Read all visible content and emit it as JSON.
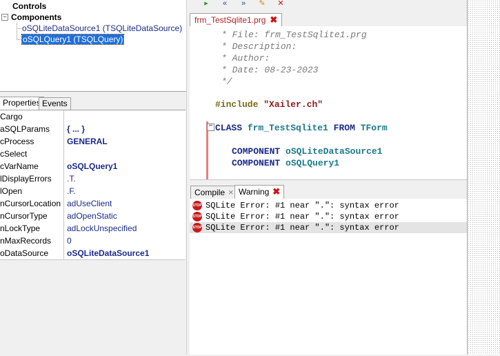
{
  "tree": {
    "controls": "Controls",
    "components": "Components",
    "items": [
      "oSQLiteDataSource1  (TSQLiteDataSource)",
      "oSQLQuery1  (TSQLQuery)"
    ],
    "expander_symbol": "−"
  },
  "property_tabs": [
    "Properties",
    "Events"
  ],
  "properties": [
    {
      "name": "Cargo",
      "value": ""
    },
    {
      "name": "aSQLParams",
      "value": "{ ... }"
    },
    {
      "name": "cProcess",
      "value": "GENERAL"
    },
    {
      "name": "cSelect",
      "value": ""
    },
    {
      "name": "cVarName",
      "value": "oSQLQuery1"
    },
    {
      "name": "lDisplayErrors",
      "value": ".T."
    },
    {
      "name": "lOpen",
      "value": ".F."
    },
    {
      "name": "nCursorLocation",
      "value": "adUseClient"
    },
    {
      "name": "nCursorType",
      "value": "adOpenStatic"
    },
    {
      "name": "nLockType",
      "value": "adLockUnspecified"
    },
    {
      "name": "nMaxRecords",
      "value": "0"
    },
    {
      "name": "oDataSource",
      "value": "oSQLiteDataSource1"
    }
  ],
  "toolbar_icons": [
    "run-icon",
    "back-icon",
    "forward-icon",
    "edit-icon",
    "delete-icon"
  ],
  "editor": {
    "tab_label": "frm_TestSqlite1.prg",
    "lines": {
      "c1": "* File: frm_TestSqlite1.prg",
      "c2": "* Description:",
      "c3": "* Author:",
      "c4": "* Date: 08-23-2023",
      "c5": "*/",
      "include_kw": "#include",
      "include_str": "\"Xailer.ch\"",
      "class_kw": "CLASS",
      "class_name": "frm_TestSqlite1",
      "from_kw": "FROM",
      "parent": "TForm",
      "comp_kw": "COMPONENT",
      "comp1": "oSQLiteDataSource1",
      "comp2": "oSQLQuery1"
    },
    "fold_symbol": "−"
  },
  "output": {
    "tabs": [
      {
        "label": "Compile",
        "close": "×"
      },
      {
        "label": "Warning",
        "close": "✖"
      }
    ],
    "icon_text": "STOP",
    "messages": [
      "SQLite Error: #1 near \".\": syntax error",
      "SQLite Error: #1 near \".\": syntax error",
      "SQLite Error: #1 near \".\": syntax error"
    ]
  },
  "close_glyph": "✖",
  "colors": {
    "selection": "#1e6fd9",
    "keyword": "#1a2a8a",
    "identifier": "#1a7a8a",
    "error": "#c81a1a"
  }
}
